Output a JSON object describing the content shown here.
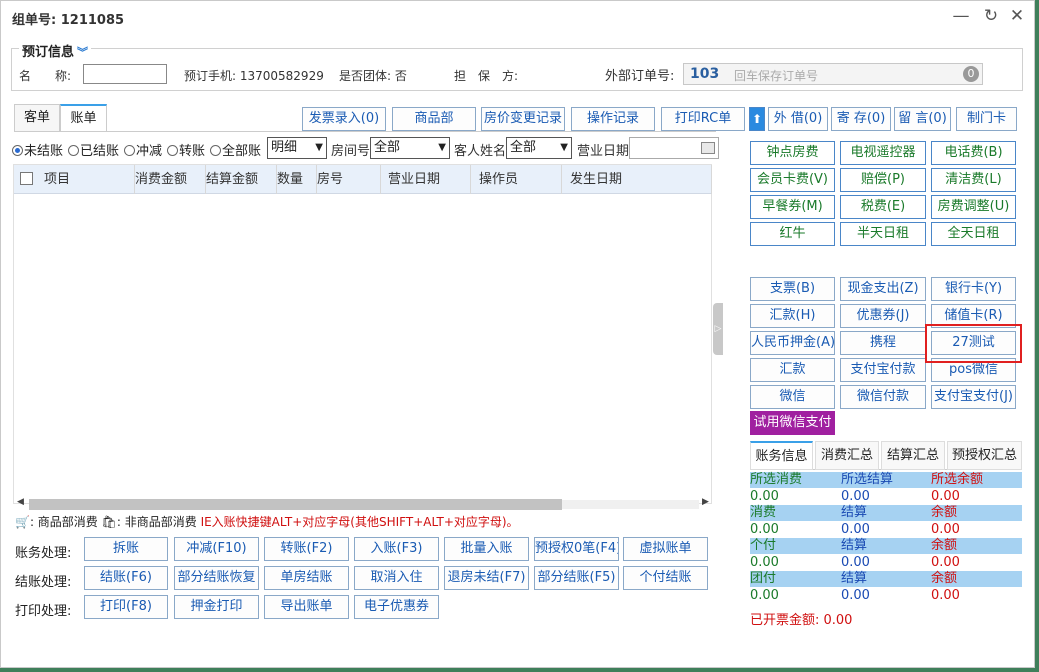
{
  "window": {
    "title": "组单号: 1211085",
    "minimize": "—",
    "restore": "↻",
    "close": "✕"
  },
  "booking": {
    "legend": "预订信息",
    "name_label": "名　　称:",
    "name_value": "",
    "phone_label": "预订手机: 13700582929",
    "group_label": "是否团体: 否",
    "guarantee_label": "担　保　方:",
    "ext_order_label": "外部订单号:",
    "ext_order_value": "103",
    "ext_order_placeholder": "回车保存订单号",
    "ext_order_clear": "0"
  },
  "tabs": [
    "客单",
    "账单"
  ],
  "active_tab": "账单",
  "toolbar": [
    "发票录入(0)",
    "商品部",
    "房价变更记录",
    "操作记录",
    "打印RC单",
    "外 借(0)",
    "寄 存(0)",
    "留 言(0)",
    "制门卡"
  ],
  "up_arrow": "⬆",
  "filters": {
    "radios": [
      "未结账",
      "已结账",
      "冲减",
      "转账",
      "全部账"
    ],
    "selected_radio": "未结账",
    "detail_select": "明细",
    "room_label": "房间号",
    "room_select": "全部",
    "guest_label": "客人姓名",
    "guest_select": "全部",
    "bizdate_label": "营业日期",
    "bizdate_value": ""
  },
  "grid_columns": [
    "项目",
    "消费金额",
    "结算金额",
    "数量",
    "房号",
    "营业日期",
    "操作员",
    "发生日期"
  ],
  "legend_line": {
    "icon1": "🛒",
    "text1": ": 商品部消费",
    "icon2": "🛍",
    "text2": ": 非商品部消费",
    "hint": "IE入账快捷键ALT+对应字母(其他SHIFT+ALT+对应字母)。"
  },
  "actions": {
    "account_label": "账务处理:",
    "account_buttons": [
      "拆账",
      "冲减(F10)",
      "转账(F2)",
      "入账(F3)",
      "批量入账",
      "预授权0笔(F4)",
      "虚拟账单"
    ],
    "checkout_label": "结账处理:",
    "checkout_buttons": [
      "结账(F6)",
      "部分结账恢复",
      "单房结账",
      "取消入住",
      "退房未结(F7)",
      "部分结账(F5)",
      "个付结账"
    ],
    "print_label": "打印处理:",
    "print_buttons": [
      "打印(F8)",
      "押金打印",
      "导出账单",
      "电子优惠券"
    ]
  },
  "charge_buttons": [
    "钟点房费",
    "电视遥控器",
    "电话费(B)",
    "会员卡费(V)",
    "赔偿(P)",
    "清洁费(L)",
    "早餐券(M)",
    "税费(E)",
    "房费调整(U)",
    "红牛",
    "半天日租",
    "全天日租"
  ],
  "payment_buttons": [
    "支票(B)",
    "现金支出(Z)",
    "银行卡(Y)",
    "汇款(H)",
    "优惠券(J)",
    "储值卡(R)",
    "人民币押金(A)",
    "携程",
    "27测试",
    "汇款",
    "支付宝付款",
    "pos微信",
    "微信",
    "微信付款",
    "支付宝支付(J)"
  ],
  "trial_wechat": "试用微信支付",
  "summary_tabs": [
    "账务信息",
    "消费汇总",
    "结算汇总",
    "预授权汇总"
  ],
  "summary_rows": [
    {
      "h1": "所选消费",
      "h2": "所选结算",
      "h3": "所选余额",
      "v1": "0.00",
      "v2": "0.00",
      "v3": "0.00"
    },
    {
      "h1": "消费",
      "h2": "结算",
      "h3": "余额",
      "v1": "0.00",
      "v2": "0.00",
      "v3": "0.00"
    },
    {
      "h1": "个付",
      "h2": "结算",
      "h3": "余额",
      "v1": "0.00",
      "v2": "0.00",
      "v3": "0.00"
    },
    {
      "h1": "团付",
      "h2": "结算",
      "h3": "余额",
      "v1": "0.00",
      "v2": "0.00",
      "v3": "0.00"
    }
  ],
  "invoiced": "已开票金额: 0.00"
}
